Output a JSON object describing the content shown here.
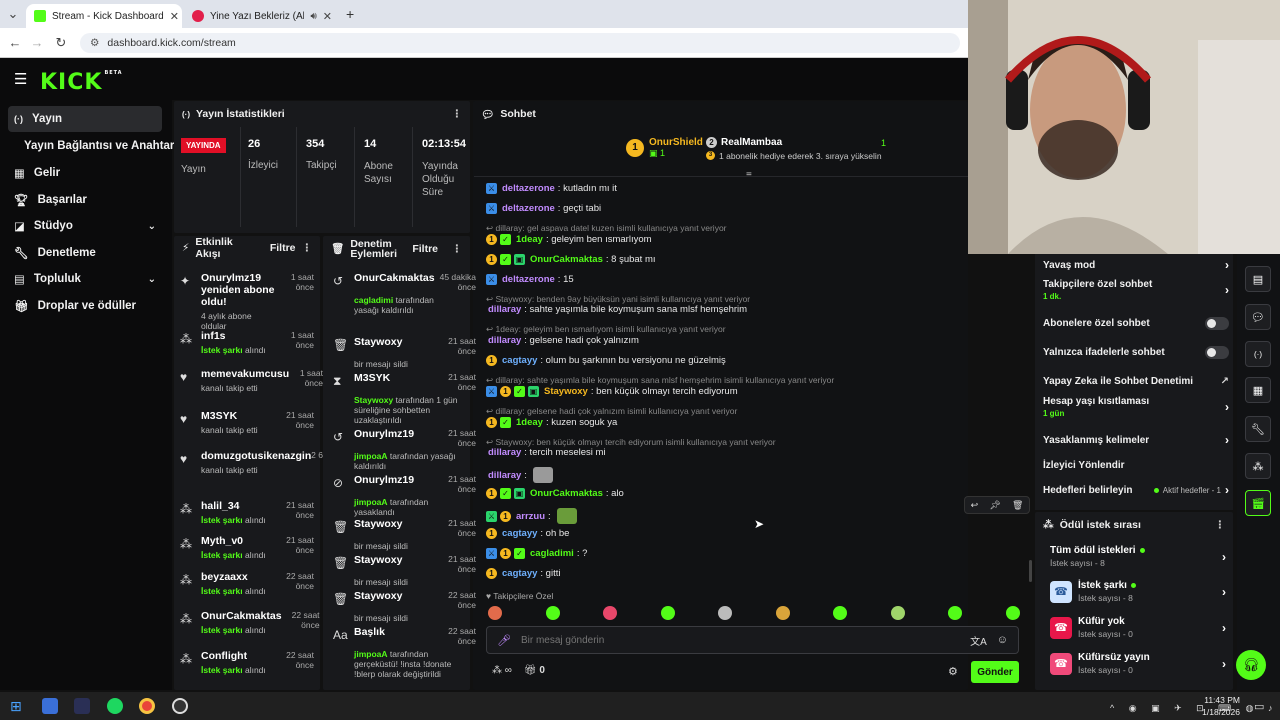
{
  "browser": {
    "tabs": [
      {
        "title": "Stream - Kick Dashboard",
        "active": true
      },
      {
        "title": "Yine Yazı Bekleriz (Akustik)",
        "active": false
      }
    ],
    "url": "dashboard.kick.com/stream"
  },
  "sidebar": {
    "items": [
      {
        "label": "Yayın",
        "icon": "broadcast-icon",
        "active": true
      },
      {
        "label": "Yayın Bağlantısı ve Anahtarı",
        "icon": "",
        "active": false
      },
      {
        "label": "Gelir",
        "icon": "chart-icon",
        "active": false
      },
      {
        "label": "Başarılar",
        "icon": "trophy-icon",
        "active": false
      },
      {
        "label": "Stüdyo",
        "icon": "studio-icon",
        "active": false,
        "expandable": true
      },
      {
        "label": "Denetleme",
        "icon": "wrench-icon",
        "active": false
      },
      {
        "label": "Topluluk",
        "icon": "community-icon",
        "active": false,
        "expandable": true
      },
      {
        "label": "Droplar ve ödüller",
        "icon": "gift-icon",
        "active": false
      }
    ]
  },
  "stats": {
    "title": "Yayın İstatistikleri",
    "status": "YAYINDA",
    "status_label": "Yayın",
    "viewers": "26",
    "viewers_label": "İzleyici",
    "followers": "354",
    "followers_label": "Takipçi",
    "subs": "14",
    "subs_label": "Abone Sayısı",
    "uptime": "02:13:54",
    "uptime_label": "Yayında Olduğu Süre"
  },
  "activity": {
    "title": "Etkinlik Akışı",
    "filter": "Filtre",
    "items": [
      {
        "icon": "sparkle-icon",
        "name": "Onurylmz19 yeniden abone oldu!",
        "sub": "4 aylık abone oldular",
        "sub_hl": "",
        "time": "1 saat önce"
      },
      {
        "icon": "points-icon",
        "name": "inf1s",
        "sub_hl": "İstek şarkı",
        "sub": "alındı",
        "time": "1 saat önce"
      },
      {
        "icon": "heart-icon",
        "name": "memevakumcusu",
        "sub_hl": "",
        "sub": "kanalı takip etti",
        "time": "1 saat önce"
      },
      {
        "icon": "heart-icon",
        "name": "M3SYK",
        "sub_hl": "",
        "sub": "kanalı takip etti",
        "time": "21 saat önce"
      },
      {
        "icon": "heart-icon",
        "name": "domuzgotusikenazgin",
        "sub_hl": "",
        "sub": "kanalı takip etti",
        "time": "2 6"
      },
      {
        "icon": "points-icon",
        "name": "halil_34",
        "sub_hl": "İstek şarkı",
        "sub": "alındı",
        "time": "21 saat önce"
      },
      {
        "icon": "points-icon",
        "name": "Myth_v0",
        "sub_hl": "İstek şarkı",
        "sub": "alındı",
        "time": "21 saat önce"
      },
      {
        "icon": "points-icon",
        "name": "beyzaaxx",
        "sub_hl": "İstek şarkı",
        "sub": "alındı",
        "time": "22 saat önce"
      },
      {
        "icon": "points-icon",
        "name": "OnurCakmaktas",
        "sub_hl": "İstek şarkı",
        "sub": "alındı",
        "time": "22 saat önce"
      },
      {
        "icon": "points-icon",
        "name": "Conflight",
        "sub_hl": "İstek şarkı",
        "sub": "alındı",
        "time": "22 saat önce"
      }
    ]
  },
  "modlog": {
    "title": "Denetim Eylemleri",
    "filter": "Filtre",
    "items": [
      {
        "icon": "undo-icon",
        "name": "OnurCakmaktas",
        "hl": "cagladimi",
        "sub": "tarafından yasağı kaldırıldı",
        "time": "45 dakika önce"
      },
      {
        "icon": "trash-icon",
        "name": "Staywoxy",
        "hl": "",
        "sub": "bir mesajı sildi",
        "time": "21 saat önce"
      },
      {
        "icon": "hourglass-icon",
        "name": "M3SYK",
        "hl": "Staywoxy",
        "sub": "tarafından 1 gün süreliğine sohbetten uzaklaştırıldı",
        "time": "21 saat önce"
      },
      {
        "icon": "undo-icon",
        "name": "Onurylmz19",
        "hl": "jimpoaA",
        "sub": "tarafından yasağı kaldırıldı",
        "time": "21 saat önce"
      },
      {
        "icon": "ban-icon",
        "name": "Onurylmz19",
        "hl": "jimpoaA",
        "sub": "tarafından yasaklandı",
        "time": "21 saat önce"
      },
      {
        "icon": "trash-icon",
        "name": "Staywoxy",
        "hl": "",
        "sub": "bir mesajı sildi",
        "time": "21 saat önce"
      },
      {
        "icon": "trash-icon",
        "name": "Staywoxy",
        "hl": "",
        "sub": "bir mesajı sildi",
        "time": "21 saat önce"
      },
      {
        "icon": "trash-icon",
        "name": "Staywoxy",
        "hl": "",
        "sub": "bir mesajı sildi",
        "time": "22 saat önce"
      },
      {
        "icon": "title-icon",
        "name": "Başlık",
        "hl": "jimpoaA",
        "sub": "tarafından gerçeküstü! !insta !donate !blerp olarak değiştirildi",
        "time": "22 saat önce"
      }
    ]
  },
  "chat": {
    "title": "Sohbet",
    "pinned_user1": "OnurShield",
    "pinned_count1": "1",
    "pinned_user2": "RealMambaa",
    "pinned_count2": "1",
    "pinned_note": "1 abonelik hediye ederek 3. sıraya yükselin",
    "messages": [
      {
        "type": "msg",
        "badges": [
          "blue"
        ],
        "user": "deltazerone",
        "color": "#c28cff",
        "text": ": kutladın mı it"
      },
      {
        "type": "msg",
        "badges": [
          "blue"
        ],
        "user": "deltazerone",
        "color": "#c28cff",
        "text": ": geçti tabi"
      },
      {
        "type": "reply",
        "text": "dillaray: gel aspava datel kuzen isimli kullanıcıya yanıt veriyor"
      },
      {
        "type": "msg",
        "badges": [
          "gold",
          "green"
        ],
        "user": "1deay",
        "color": "#53fc18",
        "text": ": geleyim ben ısmarlıyom"
      },
      {
        "type": "msg",
        "badges": [
          "gold",
          "green",
          "gift"
        ],
        "user": "OnurCakmaktas",
        "color": "#53fc18",
        "text": ": 8 şubat mı"
      },
      {
        "type": "msg",
        "badges": [
          "blue"
        ],
        "user": "deltazerone",
        "color": "#c28cff",
        "text": ": 15"
      },
      {
        "type": "reply",
        "text": "Staywoxy: benden 9ay büyüksün yani isimli kullanıcıya yanıt veriyor"
      },
      {
        "type": "msg",
        "badges": [],
        "user": "dillaray",
        "color": "#c28cff",
        "text": ": sahte yaşımla bile koymuşum sana mlsf hemşehrim"
      },
      {
        "type": "reply",
        "text": "1deay: geleyim ben ısmarlıyom isimli kullanıcıya yanıt veriyor"
      },
      {
        "type": "msg",
        "badges": [],
        "user": "dillaray",
        "color": "#c28cff",
        "text": ": gelsene hadi çok yalnızım"
      },
      {
        "type": "msg",
        "badges": [
          "gold"
        ],
        "user": "cagtayy",
        "color": "#6fb1ff",
        "text": ": olum bu şarkının bu versiyonu ne güzelmiş"
      },
      {
        "type": "reply",
        "text": "dillaray: sahte yaşımla bile koymuşum sana mlsf hemşehrim isimli kullanıcıya yanıt veriyor"
      },
      {
        "type": "msg",
        "badges": [
          "blue",
          "gold",
          "green",
          "gift"
        ],
        "user": "Staywoxy",
        "color": "#f5b820",
        "text": ": ben küçük olmayı tercih ediyorum"
      },
      {
        "type": "reply",
        "text": "dillaray: gelsene hadi çok yalnızım isimli kullanıcıya yanıt veriyor"
      },
      {
        "type": "msg",
        "badges": [
          "gold",
          "green"
        ],
        "user": "1deay",
        "color": "#53fc18",
        "text": ": kuzen soguk ya"
      },
      {
        "type": "reply",
        "text": "Staywoxy: ben küçük olmayı tercih ediyorum isimli kullanıcıya yanıt veriyor"
      },
      {
        "type": "msg",
        "badges": [],
        "user": "dillaray",
        "color": "#c28cff",
        "text": ": tercih meselesi mi"
      },
      {
        "type": "msg",
        "badges": [],
        "user": "dillaray",
        "color": "#c28cff",
        "text": ":",
        "emote": true
      },
      {
        "type": "msg",
        "badges": [
          "gold",
          "green",
          "gift"
        ],
        "user": "OnurCakmaktas",
        "color": "#53fc18",
        "text": ": alo"
      },
      {
        "type": "msg",
        "badges": [
          "green2",
          "gold"
        ],
        "user": "arrzuu",
        "color": "#c28cff",
        "text": ":",
        "emote": true
      },
      {
        "type": "msg",
        "badges": [
          "gold"
        ],
        "user": "cagtayy",
        "color": "#6fb1ff",
        "text": ": oh be"
      },
      {
        "type": "msg",
        "badges": [
          "blue",
          "gold",
          "green"
        ],
        "user": "cagladimi",
        "color": "#53fc18",
        "text": ": ?"
      },
      {
        "type": "msg",
        "badges": [
          "gold"
        ],
        "user": "cagtayy",
        "color": "#6fb1ff",
        "text": ": gitti"
      }
    ],
    "followers_only": "Takipçilere Özel",
    "input_placeholder": "Bir mesaj gönderin",
    "points": "∞",
    "drops": "0",
    "send": "Gönder"
  },
  "chat_settings": [
    {
      "label": "Yavaş mod",
      "sub": "",
      "control": "arrow"
    },
    {
      "label": "Takipçilere özel sohbet",
      "sub": "1 dk.",
      "control": "arrow"
    },
    {
      "label": "Abonelere özel sohbet",
      "sub": "",
      "control": "toggle"
    },
    {
      "label": "Yalnızca ifadelerle sohbet",
      "sub": "",
      "control": "toggle"
    },
    {
      "label": "Yapay Zeka ile Sohbet Denetimi",
      "sub": "",
      "control": "external"
    },
    {
      "label": "Hesap yaşı kısıtlaması",
      "sub": "1 gün",
      "control": "arrow"
    },
    {
      "label": "Yasaklanmış kelimeler",
      "sub": "",
      "control": "arrow"
    },
    {
      "label": "İzleyici Yönlendir",
      "sub": "",
      "control": "none"
    },
    {
      "label": "Hedefleri belirleyin",
      "sub": "",
      "control": "arrow",
      "extra": "Aktif hedefler - 1"
    }
  ],
  "rewards": {
    "title": "Ödül istek sırası",
    "items": [
      {
        "name": "Tüm ödül istekleri",
        "sub": "İstek sayısı - 8",
        "icon": ""
      },
      {
        "name": "İstek şarkı",
        "sub": "İstek sayısı - 8",
        "icon": "phone-icon",
        "color": "#cfe4ff"
      },
      {
        "name": "Küfür yok",
        "sub": "İstek sayısı - 0",
        "icon": "phone-icon",
        "color": "#e8174a"
      },
      {
        "name": "Küfürsüz yayın",
        "sub": "İstek sayısı - 0",
        "icon": "phone-icon",
        "color": "#f04a7a"
      }
    ]
  },
  "taskbar": {
    "time": "11:43 PM",
    "date": "1/18/2026"
  }
}
